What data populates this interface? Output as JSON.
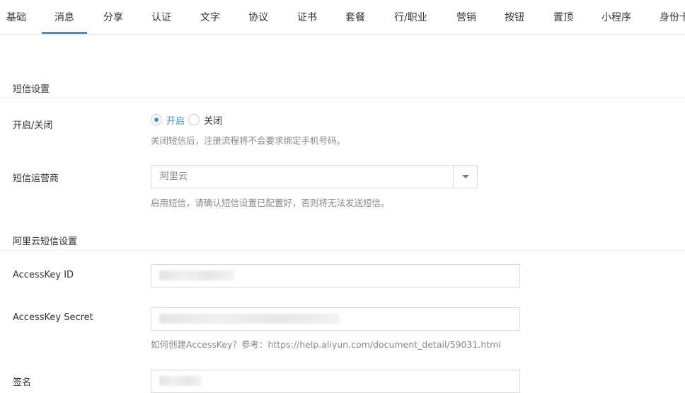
{
  "tabs": [
    {
      "label": "基础"
    },
    {
      "label": "消息"
    },
    {
      "label": "分享"
    },
    {
      "label": "认证"
    },
    {
      "label": "文字"
    },
    {
      "label": "协议"
    },
    {
      "label": "证书"
    },
    {
      "label": "套餐"
    },
    {
      "label": "行/职业"
    },
    {
      "label": "营销"
    },
    {
      "label": "按钮"
    },
    {
      "label": "置顶"
    },
    {
      "label": "小程序"
    },
    {
      "label": "身份卡"
    }
  ],
  "active_tab": "消息",
  "sms_section": {
    "title": "短信设置",
    "toggle_label": "开启/关闭",
    "option_on": "开启",
    "option_off": "关闭",
    "toggle_help": "关闭短信后，注册流程将不会要求绑定手机号码。",
    "provider_label": "短信运营商",
    "provider_value": "阿里云",
    "provider_help": "启用短信，请确认短信设置已配置好，否则将无法发送短信。"
  },
  "aliyun_section": {
    "title": "阿里云短信设置",
    "access_key_id_label": "AccessKey ID",
    "access_key_secret_label": "AccessKey Secret",
    "access_key_help": "如何创建AccessKey？参考：https://help.aliyun.com/document_detail/59031.html",
    "signature_label": "签名"
  },
  "colors": {
    "accent": "#3a8ee6",
    "help_text": "#888888",
    "border": "#dcdcdc"
  }
}
